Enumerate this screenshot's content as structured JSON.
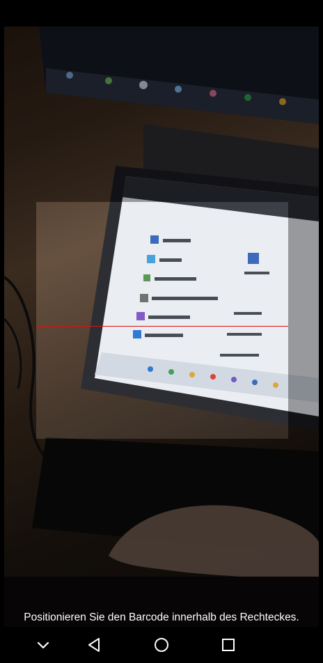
{
  "scanner": {
    "instruction": "Positionieren Sie den Barcode innerhalb des Rechteckes."
  },
  "navigation": {
    "icons": [
      "chevron-down-icon",
      "back-triangle-icon",
      "home-circle-icon",
      "recents-square-icon"
    ]
  },
  "colors": {
    "scan_line": "#e01010",
    "background": "#000000",
    "text": "#ffffff"
  }
}
